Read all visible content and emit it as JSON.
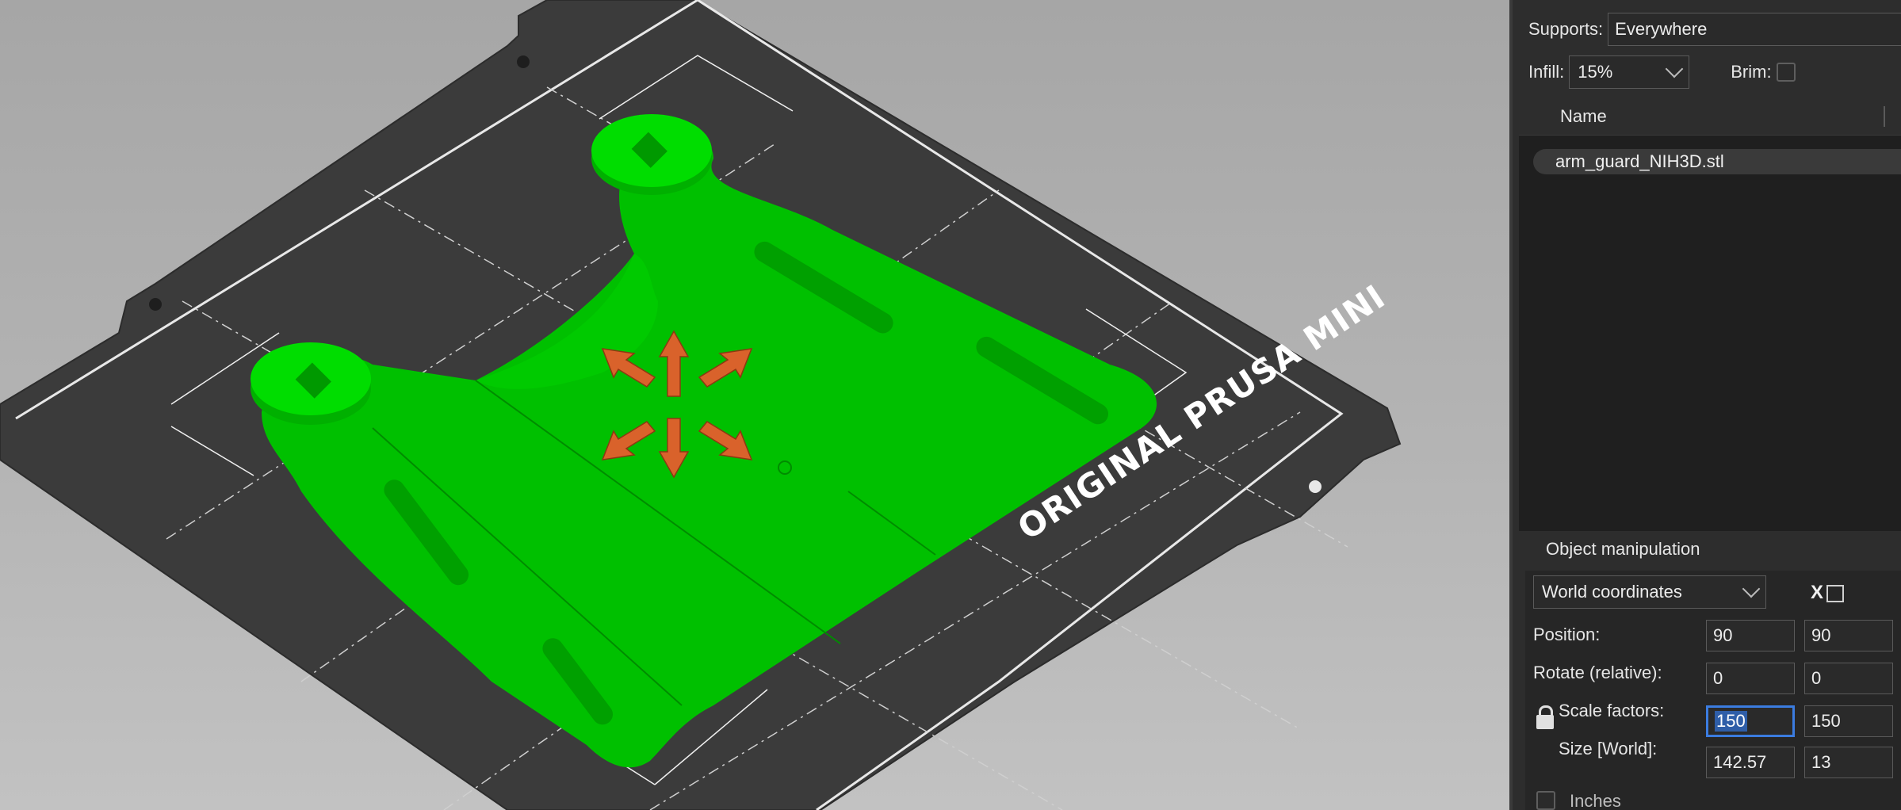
{
  "viewport": {
    "bed_label": "ORIGINAL PRUSA MINI",
    "colors": {
      "bed": "#3a3a3a",
      "model": "#00d400",
      "gizmo": "#d9622b"
    },
    "gizmo_icon": "move-arrows-icon"
  },
  "panel": {
    "supports": {
      "label": "Supports:",
      "value": "Everywhere"
    },
    "infill": {
      "label": "Infill:",
      "value": "15%"
    },
    "brim": {
      "label": "Brim:",
      "checked": false
    },
    "object_list": {
      "column_name": "Name",
      "items": [
        {
          "name": "arm_guard_NIH3D.stl"
        }
      ]
    },
    "object_manipulation": {
      "title": "Object manipulation",
      "coordinates": "World coordinates",
      "axis_label": "X",
      "position": {
        "label": "Position:",
        "x": "90",
        "y": "90"
      },
      "rotate": {
        "label": "Rotate (relative):",
        "x": "0",
        "y": "0"
      },
      "scale": {
        "label": "Scale factors:",
        "x": "150",
        "y": "150"
      },
      "size": {
        "label": "Size [World]:",
        "x": "142.57",
        "y": "13"
      },
      "inches": {
        "label": "Inches",
        "checked": false
      }
    }
  }
}
